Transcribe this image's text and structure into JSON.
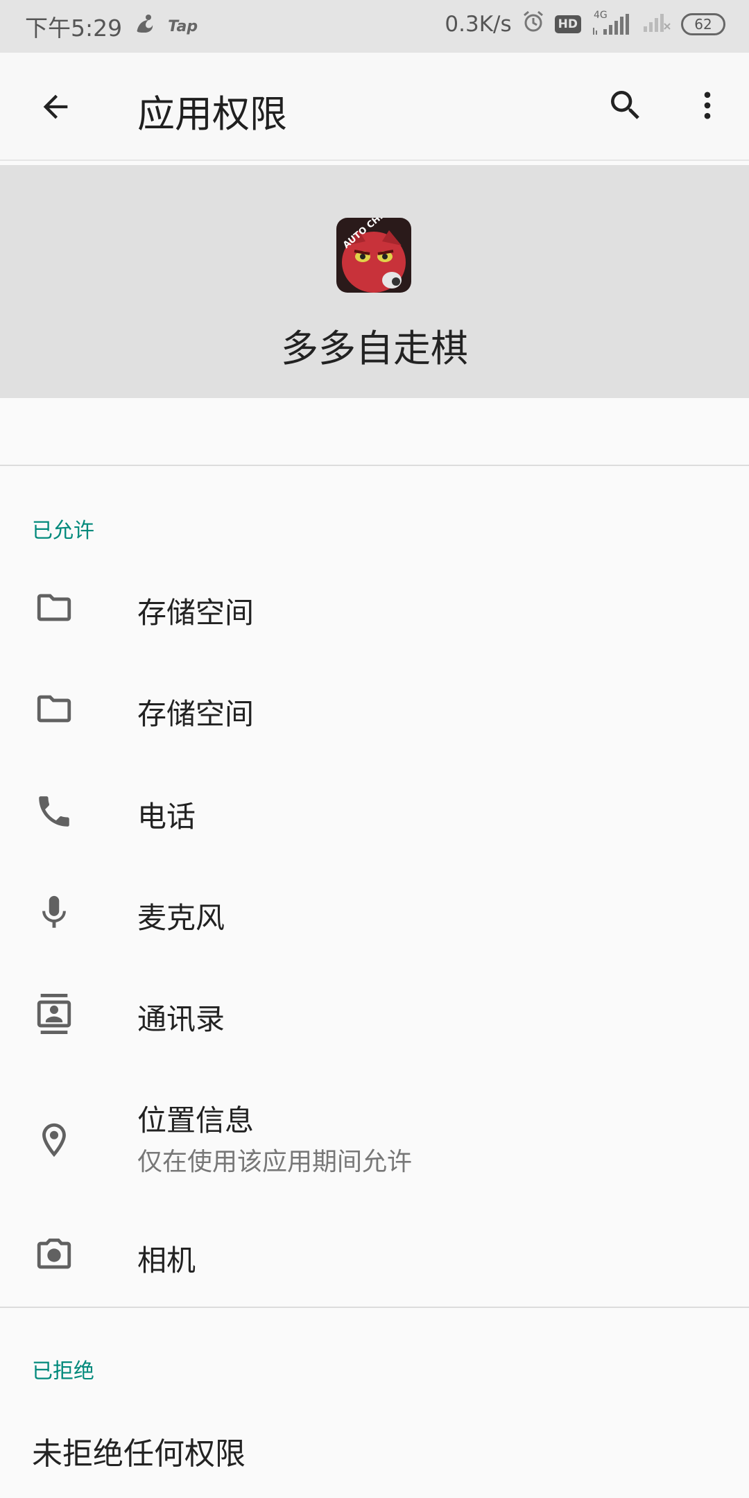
{
  "status_bar": {
    "time": "下午5:29",
    "tap_label": "Tap",
    "net_speed": "0.3K/s",
    "hd_label": "HD",
    "network_type": "4G",
    "battery": "62"
  },
  "toolbar": {
    "title": "应用权限",
    "back_icon": "arrow-back-icon",
    "search_icon": "search-icon",
    "more_icon": "more-vert-icon"
  },
  "app": {
    "name": "多多自走棋",
    "icon_text": "AUTO CHESS"
  },
  "allowed": {
    "title": "已允许",
    "items": [
      {
        "label": "存储空间",
        "icon": "folder-icon"
      },
      {
        "label": "存储空间",
        "icon": "folder-icon"
      },
      {
        "label": "电话",
        "icon": "phone-icon"
      },
      {
        "label": "麦克风",
        "icon": "microphone-icon"
      },
      {
        "label": "通讯录",
        "icon": "contacts-icon"
      },
      {
        "label": "位置信息",
        "sublabel": "仅在使用该应用期间允许",
        "icon": "location-icon"
      },
      {
        "label": "相机",
        "icon": "camera-icon"
      }
    ]
  },
  "denied": {
    "title": "已拒绝",
    "empty_text": "未拒绝任何权限"
  },
  "colors": {
    "accent": "#00897b",
    "status_bar_bg": "#e4e4e4",
    "header_bg": "#e0e0e0",
    "page_bg": "#fafafa"
  }
}
